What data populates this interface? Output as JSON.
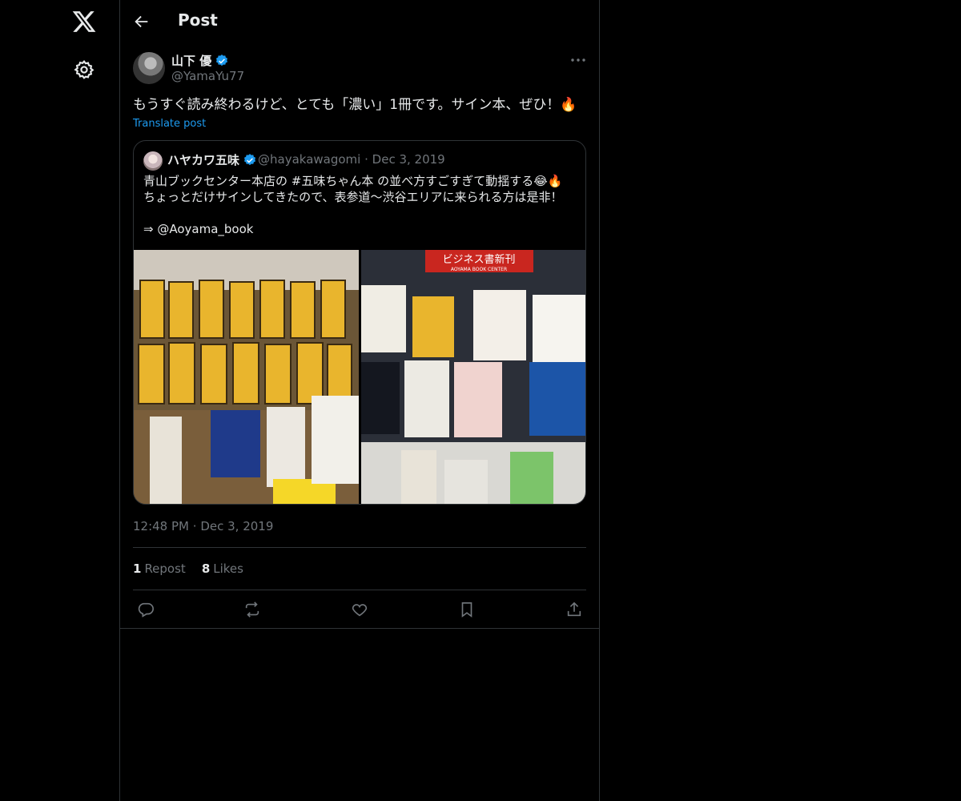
{
  "nav": {
    "logo_icon": "x-logo-icon",
    "settings_icon": "gear-icon"
  },
  "header": {
    "back_icon": "back-arrow-icon",
    "title": "Post"
  },
  "post": {
    "author_name": "山下 優",
    "author_handle": "@YamaYu77",
    "verified": true,
    "text": "もうすぐ読み終わるけど、とても「濃い」1冊です。サイン本、ぜひ！🔥",
    "translate_label": "Translate post",
    "time": "12:48 PM",
    "separator": "·",
    "date": "Dec 3, 2019",
    "reposts_count": "1",
    "reposts_label": "Repost",
    "likes_count": "8",
    "likes_label": "Likes"
  },
  "quote": {
    "author_name": "ハヤカワ五味",
    "verified": true,
    "handle": "@hayakawagomi",
    "separator": "·",
    "date": "Dec 3, 2019",
    "text": "青山ブックセンター本店の #五味ちゃん本 の並べ方すごすぎて動揺する😂🔥\nちょっとだけサインしてきたので、表参道〜渋谷エリアに来られる方は是非！\n\n⇒ @Aoyama_book",
    "right_image_caption": "ビジネス書新刊",
    "right_image_subcaption": "AOYAMA BOOK CENTER"
  },
  "actions": {
    "reply_icon": "reply-icon",
    "repost_icon": "repost-icon",
    "like_icon": "heart-icon",
    "bookmark_icon": "bookmark-icon",
    "share_icon": "share-icon"
  },
  "colors": {
    "accent": "#1d9bf0",
    "muted": "#71767b",
    "border": "#2f3336",
    "text": "#e7e9ea",
    "background": "#000000"
  }
}
